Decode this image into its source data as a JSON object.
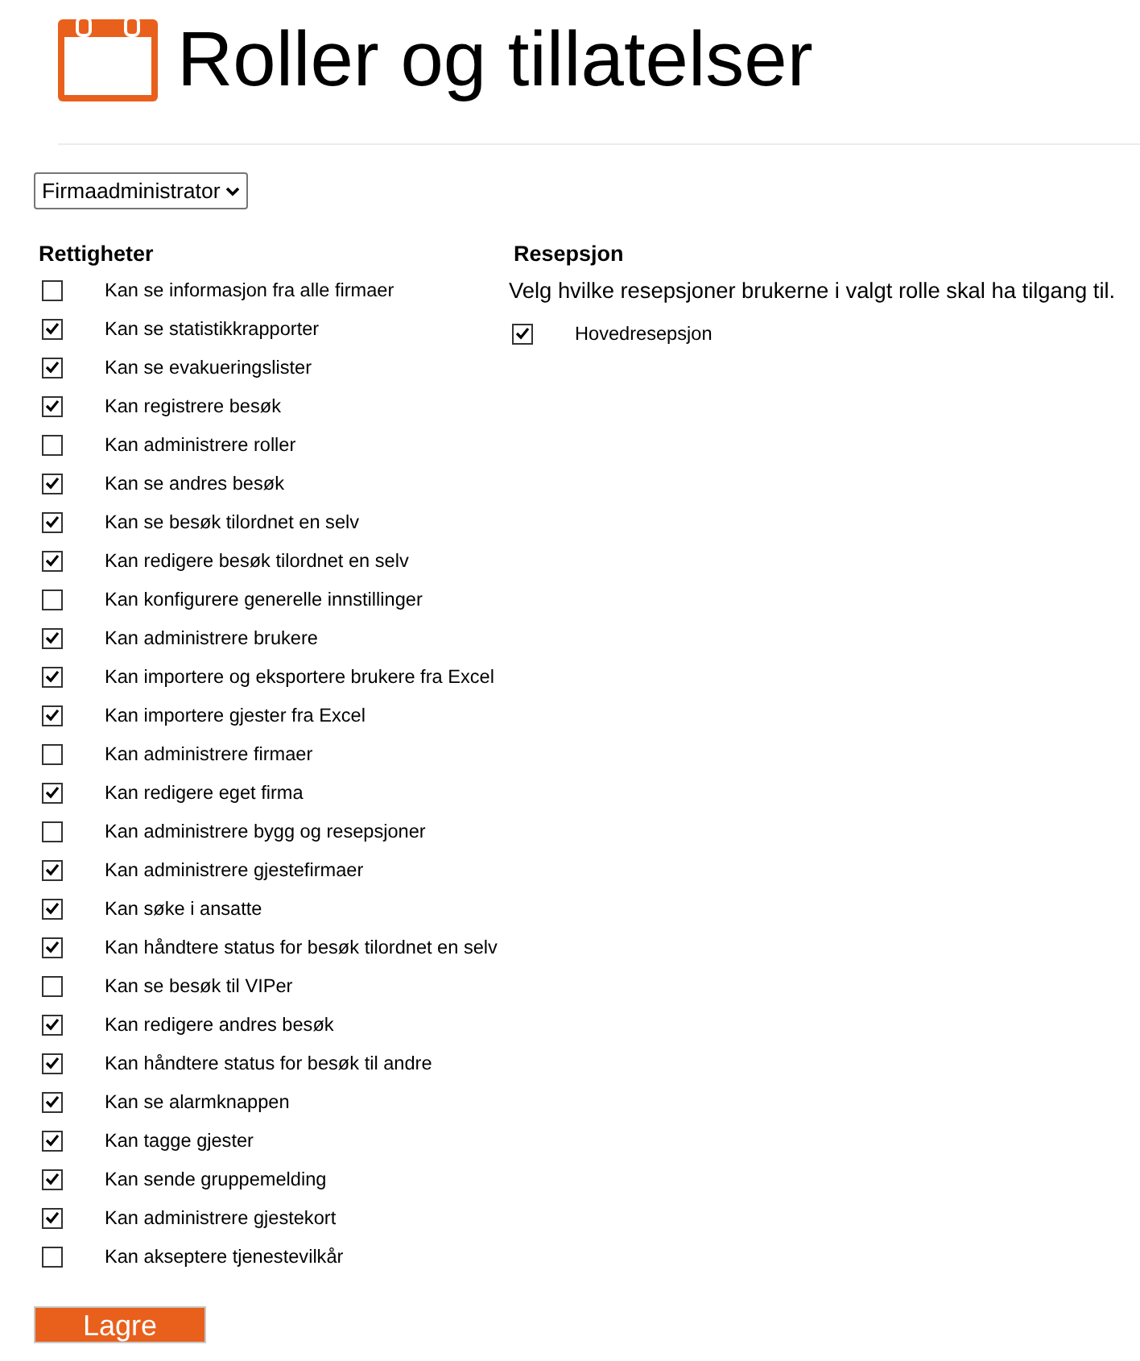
{
  "header": {
    "title": "Roller og tillatelser"
  },
  "role_select": {
    "value": "Firmaadministrator"
  },
  "permissions": {
    "heading": "Rettigheter",
    "items": [
      {
        "label": "Kan se informasjon fra alle firmaer",
        "checked": false
      },
      {
        "label": "Kan se statistikkrapporter",
        "checked": true
      },
      {
        "label": "Kan se evakueringslister",
        "checked": true
      },
      {
        "label": "Kan registrere besøk",
        "checked": true
      },
      {
        "label": "Kan administrere roller",
        "checked": false
      },
      {
        "label": "Kan se andres besøk",
        "checked": true
      },
      {
        "label": "Kan se besøk tilordnet en selv",
        "checked": true
      },
      {
        "label": "Kan redigere besøk tilordnet en selv",
        "checked": true
      },
      {
        "label": "Kan konfigurere generelle innstillinger",
        "checked": false
      },
      {
        "label": "Kan administrere brukere",
        "checked": true
      },
      {
        "label": "Kan importere og eksportere brukere fra Excel",
        "checked": true
      },
      {
        "label": "Kan importere gjester fra Excel",
        "checked": true
      },
      {
        "label": "Kan administrere firmaer",
        "checked": false
      },
      {
        "label": "Kan redigere eget firma",
        "checked": true
      },
      {
        "label": "Kan administrere bygg og resepsjoner",
        "checked": false
      },
      {
        "label": "Kan administrere gjestefirmaer",
        "checked": true
      },
      {
        "label": "Kan søke i ansatte",
        "checked": true
      },
      {
        "label": "Kan håndtere status for besøk tilordnet en selv",
        "checked": true
      },
      {
        "label": "Kan se besøk til VIPer",
        "checked": false
      },
      {
        "label": "Kan redigere andres besøk",
        "checked": true
      },
      {
        "label": "Kan håndtere status for besøk til andre",
        "checked": true
      },
      {
        "label": "Kan se alarmknappen",
        "checked": true
      },
      {
        "label": "Kan tagge gjester",
        "checked": true
      },
      {
        "label": "Kan sende gruppemelding",
        "checked": true
      },
      {
        "label": "Kan administrere gjestekort",
        "checked": true
      },
      {
        "label": "Kan akseptere tjenestevilkår",
        "checked": false
      }
    ]
  },
  "reception": {
    "heading": "Resepsjon",
    "description": "Velg hvilke resepsjoner brukerne i valgt rolle skal ha tilgang til.",
    "items": [
      {
        "label": "Hovedresepsjon",
        "checked": true
      }
    ]
  },
  "save_button": {
    "label": "Lagre"
  }
}
